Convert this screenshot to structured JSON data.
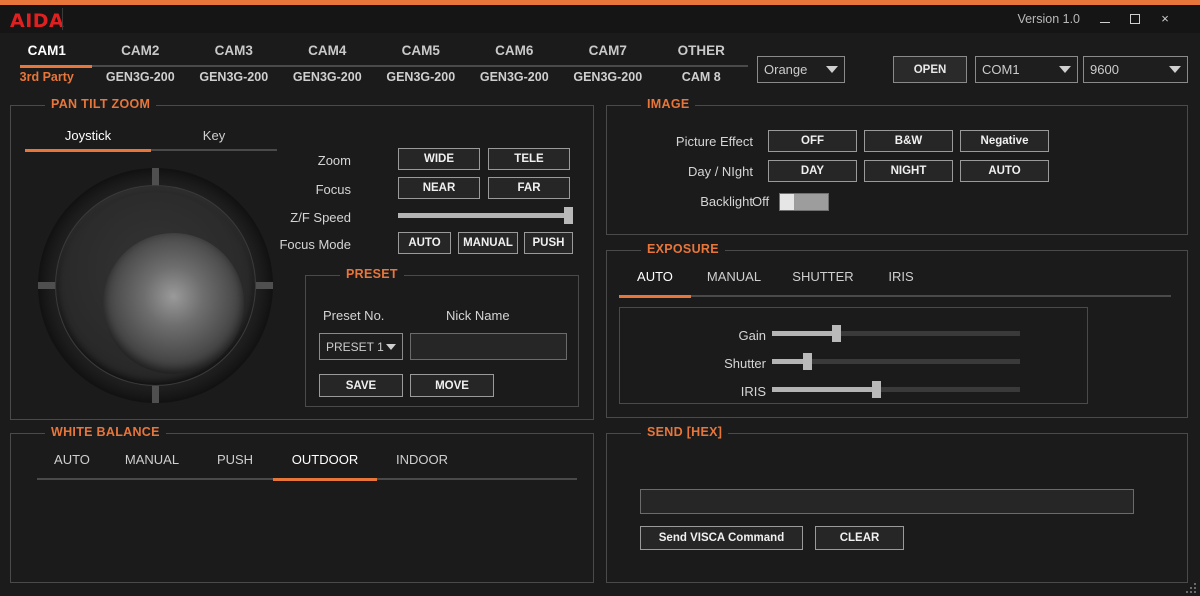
{
  "window": {
    "logo": "AIDA",
    "version": "Version 1.0",
    "minimize_label": "Minimize",
    "maximize_label": "Maximize",
    "close_label": "×",
    "accent_color": "#e8763a",
    "logo_color": "#e02020",
    "background_color": "#1b1b1b"
  },
  "tabs": {
    "items": [
      {
        "label": "CAM1",
        "sublabel": "3rd Party",
        "active": true
      },
      {
        "label": "CAM2",
        "sublabel": "GEN3G-200",
        "active": false
      },
      {
        "label": "CAM3",
        "sublabel": "GEN3G-200",
        "active": false
      },
      {
        "label": "CAM4",
        "sublabel": "GEN3G-200",
        "active": false
      },
      {
        "label": "CAM5",
        "sublabel": "GEN3G-200",
        "active": false
      },
      {
        "label": "CAM6",
        "sublabel": "GEN3G-200",
        "active": false
      },
      {
        "label": "CAM7",
        "sublabel": "GEN3G-200",
        "active": false
      },
      {
        "label": "OTHER",
        "sublabel": "CAM 8",
        "active": false
      }
    ]
  },
  "connection": {
    "color_scheme": "Orange",
    "open_label": "OPEN",
    "port": "COM1",
    "baud": "9600"
  },
  "ptz": {
    "title": "PAN TILT ZOOM",
    "mode_tabs": [
      {
        "label": "Joystick",
        "active": true
      },
      {
        "label": "Key",
        "active": false
      }
    ],
    "zoom_label": "Zoom",
    "zoom_wide": "WIDE",
    "zoom_tele": "TELE",
    "focus_label": "Focus",
    "focus_near": "NEAR",
    "focus_far": "FAR",
    "zf_speed_label": "Z/F Speed",
    "zf_speed_value": 97,
    "focus_mode_label": "Focus Mode",
    "focus_mode_auto": "AUTO",
    "focus_mode_manual": "MANUAL",
    "focus_mode_push": "PUSH"
  },
  "preset": {
    "title": "PRESET",
    "no_label": "Preset No.",
    "nick_label": "Nick Name",
    "selected": "PRESET 1",
    "nick_value": "",
    "save_label": "SAVE",
    "move_label": "MOVE"
  },
  "white_balance": {
    "title": "WHITE BALANCE",
    "tabs": [
      {
        "label": "AUTO",
        "active": false
      },
      {
        "label": "MANUAL",
        "active": false
      },
      {
        "label": "PUSH",
        "active": false
      },
      {
        "label": "OUTDOOR",
        "active": true
      },
      {
        "label": "INDOOR",
        "active": false
      }
    ]
  },
  "image": {
    "title": "IMAGE",
    "picture_effect_label": "Picture Effect",
    "picture_effect_options": [
      "OFF",
      "B&W",
      "Negative"
    ],
    "day_night_label": "Day / NIght",
    "day_night_options": [
      "DAY",
      "NIGHT",
      "AUTO"
    ],
    "backlight_label": "Backlight",
    "backlight_state": "Off"
  },
  "exposure": {
    "title": "EXPOSURE",
    "tabs": [
      {
        "label": "AUTO",
        "active": true
      },
      {
        "label": "MANUAL",
        "active": false
      },
      {
        "label": "SHUTTER",
        "active": false
      },
      {
        "label": "IRIS",
        "active": false
      }
    ],
    "sliders": [
      {
        "label": "Gain",
        "value": 26
      },
      {
        "label": "Shutter",
        "value": 14
      },
      {
        "label": "IRIS",
        "value": 42
      }
    ]
  },
  "send_hex": {
    "title": "SEND [HEX]",
    "input_value": "",
    "send_label": "Send VISCA Command",
    "clear_label": "CLEAR"
  }
}
